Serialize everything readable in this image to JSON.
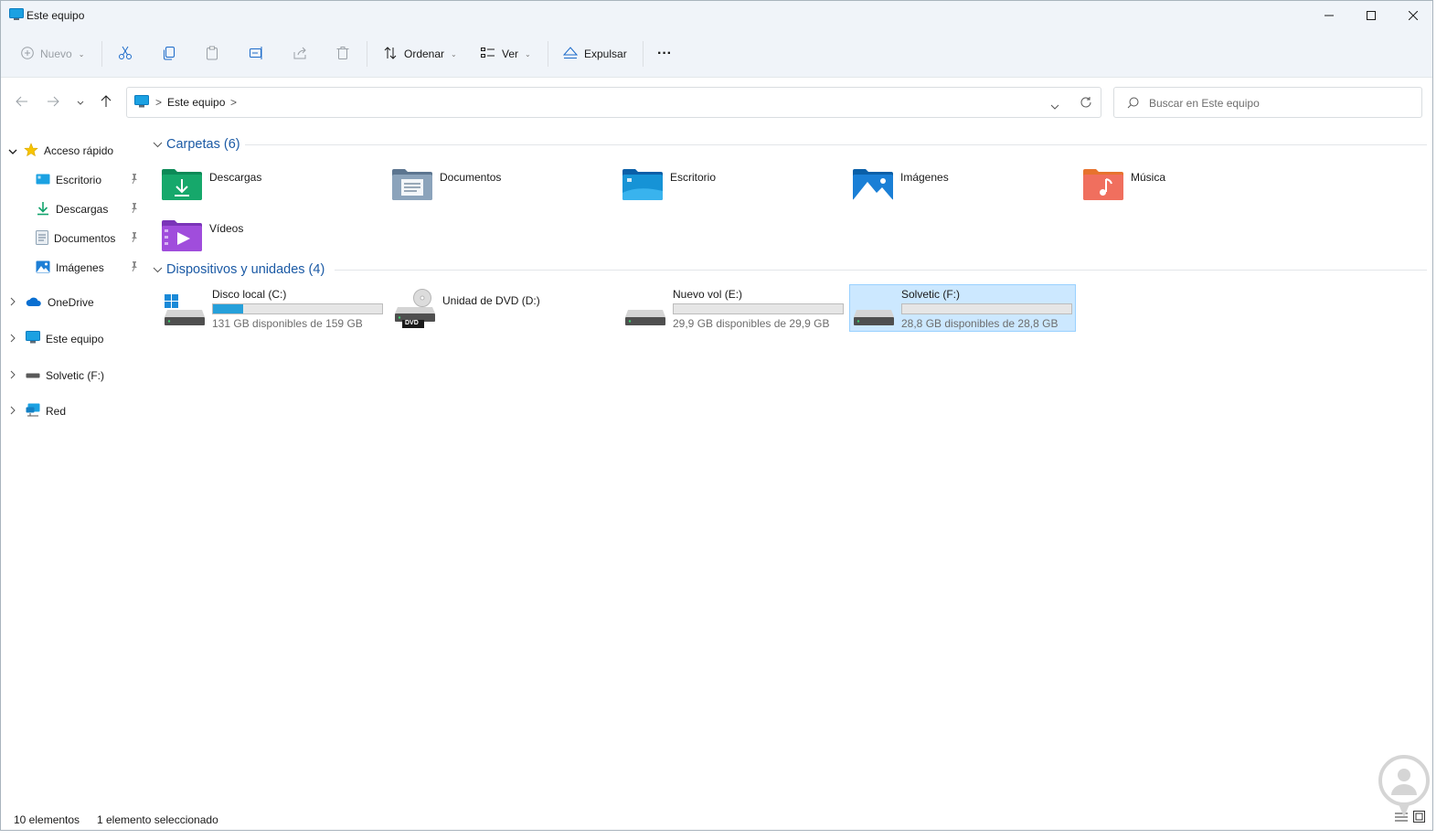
{
  "window": {
    "title": "Este equipo",
    "controls": [
      "minimize",
      "maximize",
      "close"
    ]
  },
  "toolbar": {
    "new_label": "Nuevo",
    "sort_label": "Ordenar",
    "view_label": "Ver",
    "eject_label": "Expulsar",
    "more_label": "···",
    "icons": [
      "cut-icon",
      "copy-icon",
      "paste-icon",
      "rename-icon",
      "share-icon",
      "delete-icon"
    ]
  },
  "address": {
    "crumb": "Este equipo",
    "separator_start": ">",
    "separator_end": ">"
  },
  "search": {
    "placeholder": "Buscar en Este equipo"
  },
  "sidebar": {
    "quick_access": "Acceso rápido",
    "quick_items": [
      {
        "label": "Escritorio",
        "icon": "desktop-icon"
      },
      {
        "label": "Descargas",
        "icon": "download-icon"
      },
      {
        "label": "Documentos",
        "icon": "document-icon"
      },
      {
        "label": "Imágenes",
        "icon": "image-icon"
      }
    ],
    "onedrive": "OneDrive",
    "this_pc": "Este equipo",
    "usb": "Solvetic (F:)",
    "network": "Red"
  },
  "folders": {
    "header": "Carpetas (6)",
    "items": [
      "Descargas",
      "Documentos",
      "Escritorio",
      "Imágenes",
      "Música",
      "Vídeos"
    ]
  },
  "drives": {
    "header": "Dispositivos y unidades (4)",
    "items": [
      {
        "name": "Disco local (C:)",
        "sub": "131 GB disponibles de 159 GB",
        "used_fraction": 0.176
      },
      {
        "name": "Unidad de DVD (D:)",
        "sub": "",
        "badge": "DVD"
      },
      {
        "name": "Nuevo vol (E:)",
        "sub": "29,9 GB disponibles de 29,9 GB",
        "used_fraction": 0.0
      },
      {
        "name": "Solvetic (F:)",
        "sub": "28,8 GB disponibles de 28,8 GB",
        "used_fraction": 0.0,
        "selected": true
      }
    ]
  },
  "status": {
    "count": "10 elementos",
    "selection": "1 elemento seleccionado"
  },
  "colors": {
    "accent": "#0067c0",
    "group_header": "#1b5aa5",
    "selected_bg": "#cce8ff",
    "storage_fill": "#26a0da"
  }
}
